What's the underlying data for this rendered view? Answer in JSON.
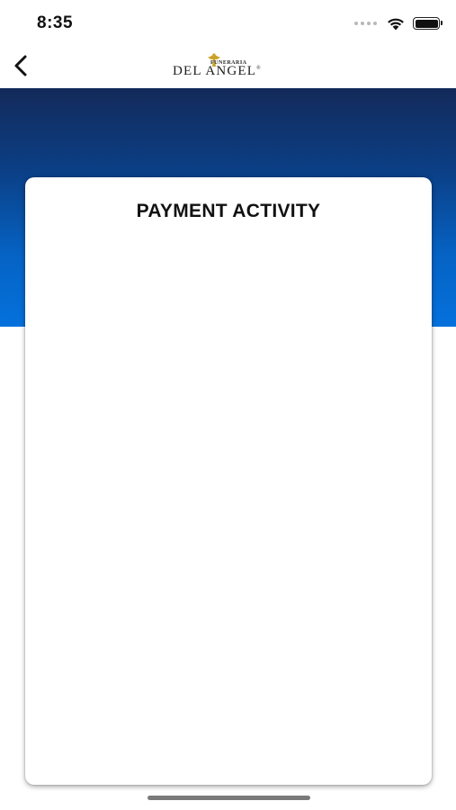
{
  "status_bar": {
    "time": "8:35",
    "signal_icon": "signal-dots-icon",
    "wifi_icon": "wifi-icon",
    "battery_icon": "battery-icon"
  },
  "nav": {
    "back_icon": "chevron-left-icon",
    "logo": {
      "small_text": "FUNERARIA",
      "main_text": "DEL ANGEL",
      "registered_mark": "®",
      "accent_color": "#c9a227"
    }
  },
  "header": {
    "gradient_top_color": "#132a5a",
    "gradient_bottom_color": "#0571dc"
  },
  "card": {
    "title": "PAYMENT ACTIVITY"
  }
}
